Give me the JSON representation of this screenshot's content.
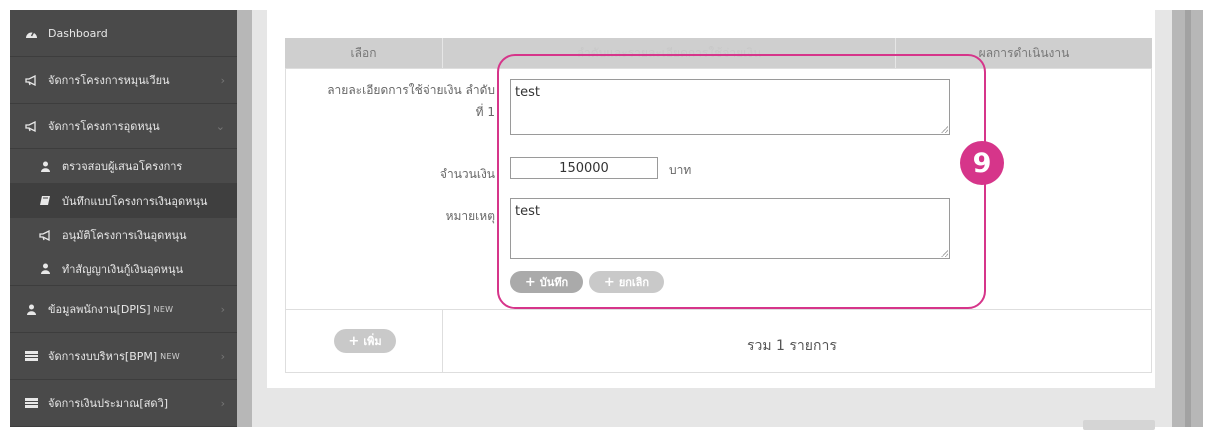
{
  "sidebar": {
    "items": [
      {
        "label": "Dashboard",
        "icon": "dashboard-icon"
      },
      {
        "label": "จัดการโครงการหมุนเวียน",
        "icon": "megaphone-icon"
      },
      {
        "label": "จัดการโครงการอุดหนุน",
        "icon": "megaphone-icon"
      },
      {
        "label": "ตรวจสอบผู้เสนอโครงการ",
        "icon": "user-icon"
      },
      {
        "label": "บันทึกแบบโครงการเงินอุดหนุน",
        "icon": "book-icon"
      },
      {
        "label": "อนุมัติโครงการเงินอุดหนุน",
        "icon": "megaphone-icon"
      },
      {
        "label": "ทำสัญญาเงินกู้เงินอุดหนุน",
        "icon": "user-icon"
      },
      {
        "label": "ข้อมูลพนักงาน[DPIS]",
        "tag": "NEW",
        "icon": "user-icon"
      },
      {
        "label": "จัดการงบบริหาร[BPM]",
        "tag": "NEW",
        "icon": "table-icon"
      },
      {
        "label": "จัดการเงินประมาณ[สดวิ]",
        "icon": "table-icon"
      }
    ]
  },
  "table": {
    "headers": [
      "เลือก",
      "ลำดับและรายละเอียดการใช้จ่ายเงิน",
      "ผลการดำเนินงาน"
    ]
  },
  "form": {
    "detail_label_line1": "ลายละเอียดการใช้จ่ายเงิน ลำดับ",
    "detail_label_line2": "ที่ 1",
    "detail_value": "test",
    "amount_label": "จำนวนเงิน",
    "amount_value": "150000",
    "amount_unit": "บาท",
    "note_label": "หมายเหตุ",
    "note_value": "test",
    "save_label": "บันทึก",
    "cancel_label": "ยกเลิก"
  },
  "footer": {
    "add_label": "เพิ่ม",
    "summary": "รวม 1 รายการ"
  },
  "annotation": {
    "badge": "9",
    "color": "#d6358a"
  }
}
